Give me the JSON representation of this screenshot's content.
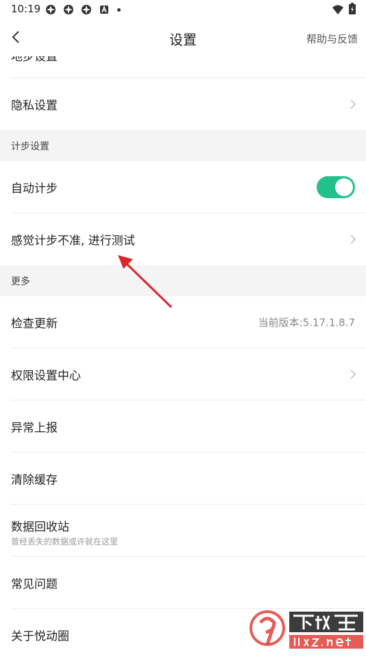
{
  "status_bar": {
    "time": "10:19"
  },
  "header": {
    "title": "设置",
    "help": "帮助与反馈"
  },
  "rows": {
    "partial": "地步设置",
    "privacy": "隐私设置",
    "auto_step": "自动计步",
    "step_test": "感觉计步不准, 进行测试",
    "check_update": "检查更新",
    "check_update_value": "当前版本:5.17.1.8.7",
    "permission": "权限设置中心",
    "report": "异常上报",
    "clear_cache": "清除缓存",
    "recycle": "数据回收站",
    "recycle_sub": "曾经丢失的数据或许就在这里",
    "faq": "常见问题",
    "about": "关于悦动圈"
  },
  "sections": {
    "step": "计步设置",
    "more": "更多"
  },
  "toggle": {
    "auto_step_on": true
  },
  "colors": {
    "accent": "#22c08a",
    "arrow": "#d9262b"
  },
  "watermark": {
    "logo_text": "9下载站",
    "url": "91xz.net"
  }
}
